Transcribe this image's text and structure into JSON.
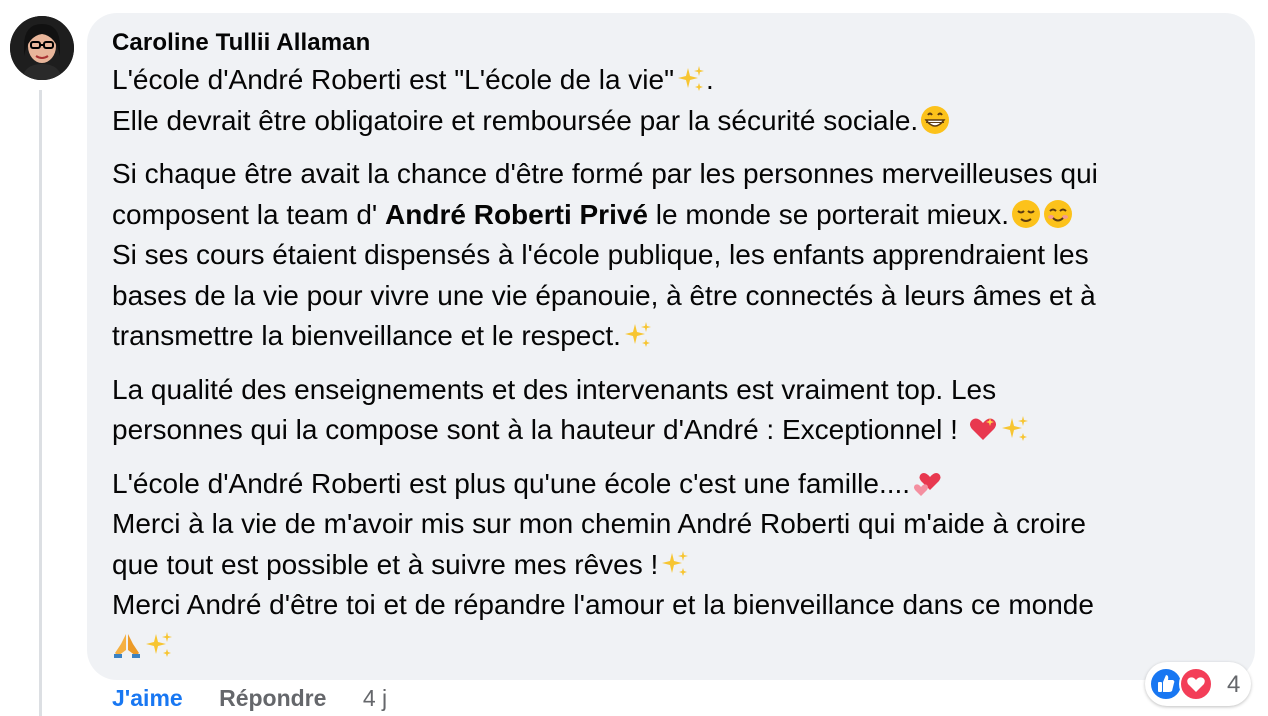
{
  "comment": {
    "author": "Caroline Tullii Allaman",
    "lines": {
      "p1a": "L'école d'André Roberti est \"L'école de la vie\"",
      "p1a_tail": ".",
      "p1b": "Elle devrait être obligatoire et remboursée par la sécurité sociale.",
      "p2a": "Si chaque être avait la chance d'être formé par les personnes merveilleuses qui",
      "p2b_pre": "composent la team d' ",
      "p2b_bold": "André Roberti Privé",
      "p2b_post": " le monde se porterait mieux.",
      "p2c": "Si ses cours étaient dispensés à l'école publique, les enfants apprendraient les",
      "p2d": "bases de la vie pour vivre une vie épanouie, à être connectés à leurs âmes et à",
      "p2e": "transmettre la bienveillance et le respect.",
      "p3a": "La qualité des enseignements et des intervenants est vraiment top. Les",
      "p3b": "personnes qui la compose sont à la hauteur d'André : Exceptionnel ! ",
      "p4a": "L'école d'André Roberti est plus qu'une école c'est une famille....",
      "p4b": "Merci à la vie de m'avoir mis sur mon chemin André Roberti qui m'aide à croire",
      "p4c": "que tout est possible et à suivre mes rêves !",
      "p4d": "Merci André d'être toi et de répandre l'amour et la bienveillance dans ce monde"
    }
  },
  "actions": {
    "like": "J'aime",
    "reply": "Répondre",
    "time": "4 j"
  },
  "reactions": {
    "count": "4",
    "icons": [
      "like-icon",
      "love-icon"
    ]
  },
  "colors": {
    "bubble": "#f0f2f5",
    "link": "#1877f2",
    "muted": "#65676b",
    "love": "#f33e58"
  }
}
